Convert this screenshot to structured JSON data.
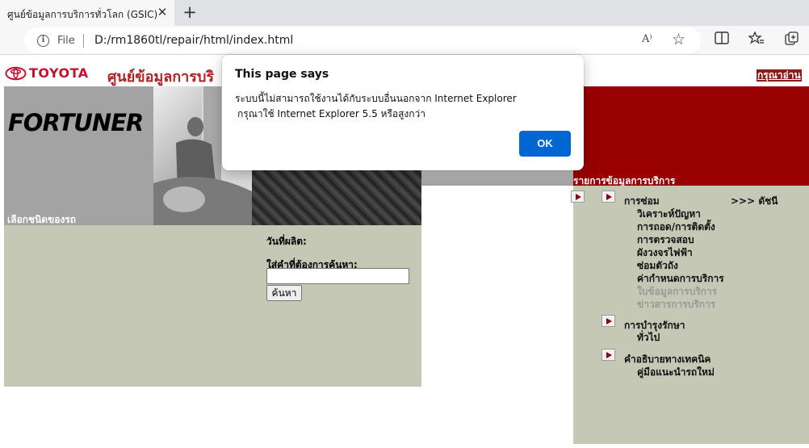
{
  "browser": {
    "tab_title": "ศูนย์ข้อมูลการบริการทั่วโลก (GSIC)",
    "close_glyph": "✕",
    "new_tab_glyph": "+",
    "scheme_label": "File",
    "url": "D:/rm1860tl/repair/html/index.html",
    "read_aloud_glyph": "A⁾",
    "info_glyph": "i",
    "icons": [
      "read-aloud-icon",
      "favorite-star-icon",
      "split-screen-icon",
      "favorites-icon",
      "collections-icon"
    ]
  },
  "page": {
    "brand": "TOYOTA",
    "title": "ศูนย์ข้อมูลการบริ",
    "read_link": "กรุณาอ่าน",
    "model_logo": "FORTUNER",
    "model_select_label": "เลือกชนิดของรถ",
    "production_date_label": "วันที่ผลิต:",
    "keyword_label": "ใส่คำที่ต้องการค้นหา:",
    "keyword_value": "",
    "search_button": "ค้นหา",
    "service_list_title": "รายการข้อมูลการบริการ",
    "index_link": ">>> ดัชนี",
    "sections": [
      {
        "title": "การซ่อม",
        "items": [
          {
            "label": "วิเคราะห์ปัญหา",
            "enabled": true
          },
          {
            "label": "การถอด/การติดตั้ง",
            "enabled": true
          },
          {
            "label": "การตรวจสอบ",
            "enabled": true
          },
          {
            "label": "ผังวงจรไฟฟ้า",
            "enabled": true
          },
          {
            "label": "ซ่อมตัวถัง",
            "enabled": true
          },
          {
            "label": "ค่ากำหนดการบริการ",
            "enabled": true
          },
          {
            "label": "ใบข้อมูลการบริการ",
            "enabled": false
          },
          {
            "label": "ข่าวสารการบริการ",
            "enabled": false
          }
        ]
      },
      {
        "title": "การบำรุงรักษา",
        "items": [
          {
            "label": "ทั่วไป",
            "enabled": true
          }
        ]
      },
      {
        "title": "คำอธิบายทางเทคนิค",
        "items": [
          {
            "label": "คู่มือแนะนำรถใหม่",
            "enabled": true
          }
        ]
      }
    ]
  },
  "dialog": {
    "title": "This page says",
    "message_line1": "ระบบนี้ไม่สามารถใช้งานได้กับระบบอื่นนอกจาก Internet Explorer",
    "message_line2": "กรุณาใช้ Internet Explorer 5.5 หรือสูงกว่า",
    "ok_label": "OK"
  },
  "colors": {
    "brand_red": "#c8102e",
    "header_red": "#990000",
    "panel_bg": "#c4c8b4",
    "dialog_button": "#0067d2",
    "disabled_text": "#9a9a9a"
  }
}
